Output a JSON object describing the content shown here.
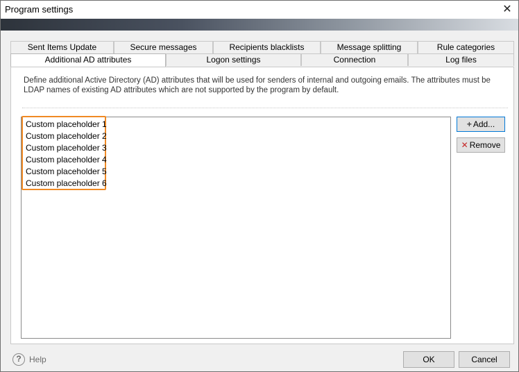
{
  "window": {
    "title": "Program settings",
    "close_glyph": "✕"
  },
  "tabs": {
    "row1": [
      "Sent Items Update",
      "Secure messages",
      "Recipients blacklists",
      "Message splitting",
      "Rule categories"
    ],
    "row2": [
      "Additional AD attributes",
      "Logon settings",
      "Connection",
      "Log files"
    ],
    "active": "Additional AD attributes"
  },
  "panel": {
    "description": "Define additional Active Directory (AD) attributes that will be used for senders of internal and outgoing emails. The attributes must be LDAP names of existing AD attributes which are not supported by the program by default.",
    "items": [
      "Custom placeholder 1",
      "Custom placeholder 2",
      "Custom placeholder 3",
      "Custom placeholder 4",
      "Custom placeholder 5",
      "Custom placeholder 6"
    ],
    "add_label": "Add...",
    "remove_label": "Remove",
    "plus_glyph": "+",
    "x_glyph": "✕"
  },
  "footer": {
    "help_label": "Help",
    "help_glyph": "?",
    "ok_label": "OK",
    "cancel_label": "Cancel"
  },
  "colors": {
    "highlight": "#f08a24",
    "default_button_border": "#0078d7",
    "remove_icon": "#c62828"
  }
}
